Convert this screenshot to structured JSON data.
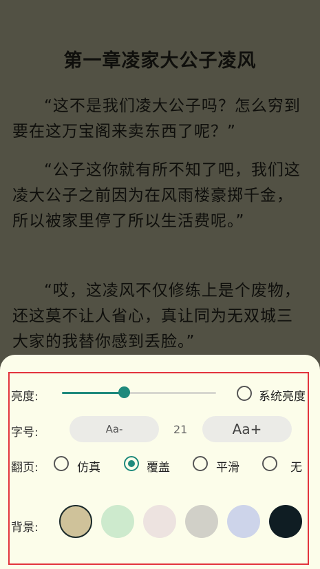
{
  "reader": {
    "chapter_title": "第一章凌家大公子凌风",
    "paragraphs": [
      "“这不是我们凌大公子吗？怎么穷到要在这万宝阁来卖东西了呢？”",
      "“公子这你就有所不知了吧，我们这凌大公子之前因为在风雨楼豪掷千金，所以被家里停了所以生活费呢。”",
      "“哎，这凌风不仅修练上是个废物，还这莫不让人省心，真让同为无双城三大家的我替你感到丢脸。”"
    ]
  },
  "settings": {
    "brightness": {
      "label": "亮度:",
      "value": 0.4,
      "system_label": "系统亮度",
      "system_checked": false
    },
    "font_size": {
      "label": "字号:",
      "decrease_label": "Aa-",
      "value": "21",
      "increase_label": "Aa+"
    },
    "page_turn": {
      "label": "翻页:",
      "options": [
        {
          "label": "仿真",
          "checked": false
        },
        {
          "label": "覆盖",
          "checked": true
        },
        {
          "label": "平滑",
          "checked": false
        },
        {
          "label": "无",
          "checked": false
        }
      ]
    },
    "background": {
      "label": "背景:",
      "swatches": [
        {
          "color": "#cfc29a",
          "selected": true
        },
        {
          "color": "#cdeacd",
          "selected": false
        },
        {
          "color": "#ede3e0",
          "selected": false
        },
        {
          "color": "#d1d0c8",
          "selected": false
        },
        {
          "color": "#cdd4ea",
          "selected": false
        },
        {
          "color": "#0f1d23",
          "selected": false
        }
      ]
    }
  },
  "colors": {
    "accent": "#1f8a7c",
    "highlight_frame": "#e2343c",
    "reader_bg": "#525144",
    "panel_bg": "#fcfdea"
  }
}
